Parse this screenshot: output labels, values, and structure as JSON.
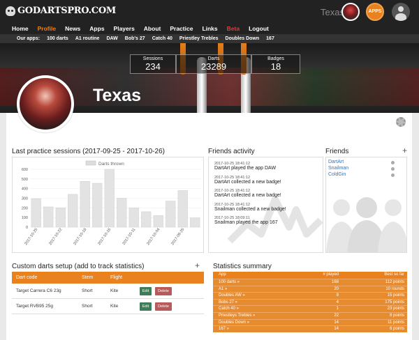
{
  "header": {
    "logo_text": "GODARTSPRO.COM",
    "user_name": "Texas",
    "apps_label": "APPS"
  },
  "nav": {
    "items": [
      "Home",
      "Profile",
      "News",
      "Apps",
      "Players",
      "About",
      "Practice",
      "Links",
      "Beta",
      "Logout"
    ],
    "active": "Profile"
  },
  "subnav": {
    "label": "Our apps:",
    "items": [
      "100 darts",
      "A1 routine",
      "DAW",
      "Bob's 27",
      "Catch 40",
      "Priestley Trebles",
      "Doubles Down",
      "167"
    ]
  },
  "stats": [
    {
      "label": "Sessions",
      "value": "234"
    },
    {
      "label": "Darts",
      "value": "23289"
    },
    {
      "label": "Badges",
      "value": "18"
    }
  ],
  "profile": {
    "name": "Texas"
  },
  "practice": {
    "title": "Last practice sessions (2017-09-25 - 2017-10-26)"
  },
  "chart_data": {
    "type": "bar",
    "legend": "Darts thrown",
    "legend_position": "top-center",
    "categories": [
      "2017-10-25",
      "",
      "2017-10-22",
      "",
      "2017-10-18",
      "",
      "2017-10-16",
      "",
      "2017-10-11",
      "",
      "2017-10-04",
      "",
      "2017-09-25",
      ""
    ],
    "values": [
      295,
      210,
      200,
      340,
      475,
      455,
      600,
      300,
      200,
      160,
      120,
      270,
      380,
      95
    ],
    "ylim": [
      0,
      600
    ],
    "yticks": [
      0,
      100,
      200,
      300,
      400,
      500,
      600
    ],
    "grid": true
  },
  "friends_activity": {
    "title": "Friends activity",
    "items": [
      {
        "time": "2017-10-25 18:41:12",
        "text": "DartArt played the app DAW"
      },
      {
        "time": "2017-10-25 18:41:12",
        "text": "DartArt collected a new badge!"
      },
      {
        "time": "2017-10-25 18:41:12",
        "text": "DartArt collected a new badge!"
      },
      {
        "time": "2017-10-25 18:41:12",
        "text": "Snailman collected a new badge!"
      },
      {
        "time": "2017-10-25 18:09:11",
        "text": "Snailman played the app 167"
      }
    ]
  },
  "friends": {
    "title": "Friends",
    "items": [
      "DartArt",
      "Snailman",
      "ColdGin"
    ]
  },
  "custom_darts": {
    "title": "Custom darts setup (add to track statistics)",
    "columns": [
      "Dart code",
      "Stem",
      "Flight"
    ],
    "rows": [
      {
        "code": "Target Carrera C6 23g",
        "stem": "Short",
        "flight": "Kite"
      },
      {
        "code": "Target RVB95 25g",
        "stem": "Short",
        "flight": "Kite"
      }
    ],
    "edit_label": "Edit",
    "delete_label": "Delete"
  },
  "summary": {
    "title": "Statistics summary",
    "columns": [
      "App",
      "# played",
      "Best so far"
    ],
    "rows": [
      {
        "app": "100 darts »",
        "played": "168",
        "best": "112 points"
      },
      {
        "app": "A1 »",
        "played": "20",
        "best": "10 rounds"
      },
      {
        "app": "Doubles AW »",
        "played": "8",
        "best": "15 points"
      },
      {
        "app": "Bobs 27 »",
        "played": "4",
        "best": "175 points"
      },
      {
        "app": "Catch 40 »",
        "played": "1",
        "best": "23 points"
      },
      {
        "app": "Priestleys Trebles »",
        "played": "22",
        "best": "8 points"
      },
      {
        "app": "Doubles Down »",
        "played": "14",
        "best": "11 points"
      },
      {
        "app": "167 »",
        "played": "14",
        "best": "6 points"
      }
    ]
  },
  "colors": {
    "accent": "#e8811e",
    "nav_bg": "#222222",
    "beta": "#e23b3b",
    "link": "#3a70b5",
    "edit": "#3e7d57",
    "delete": "#b85a5a"
  }
}
